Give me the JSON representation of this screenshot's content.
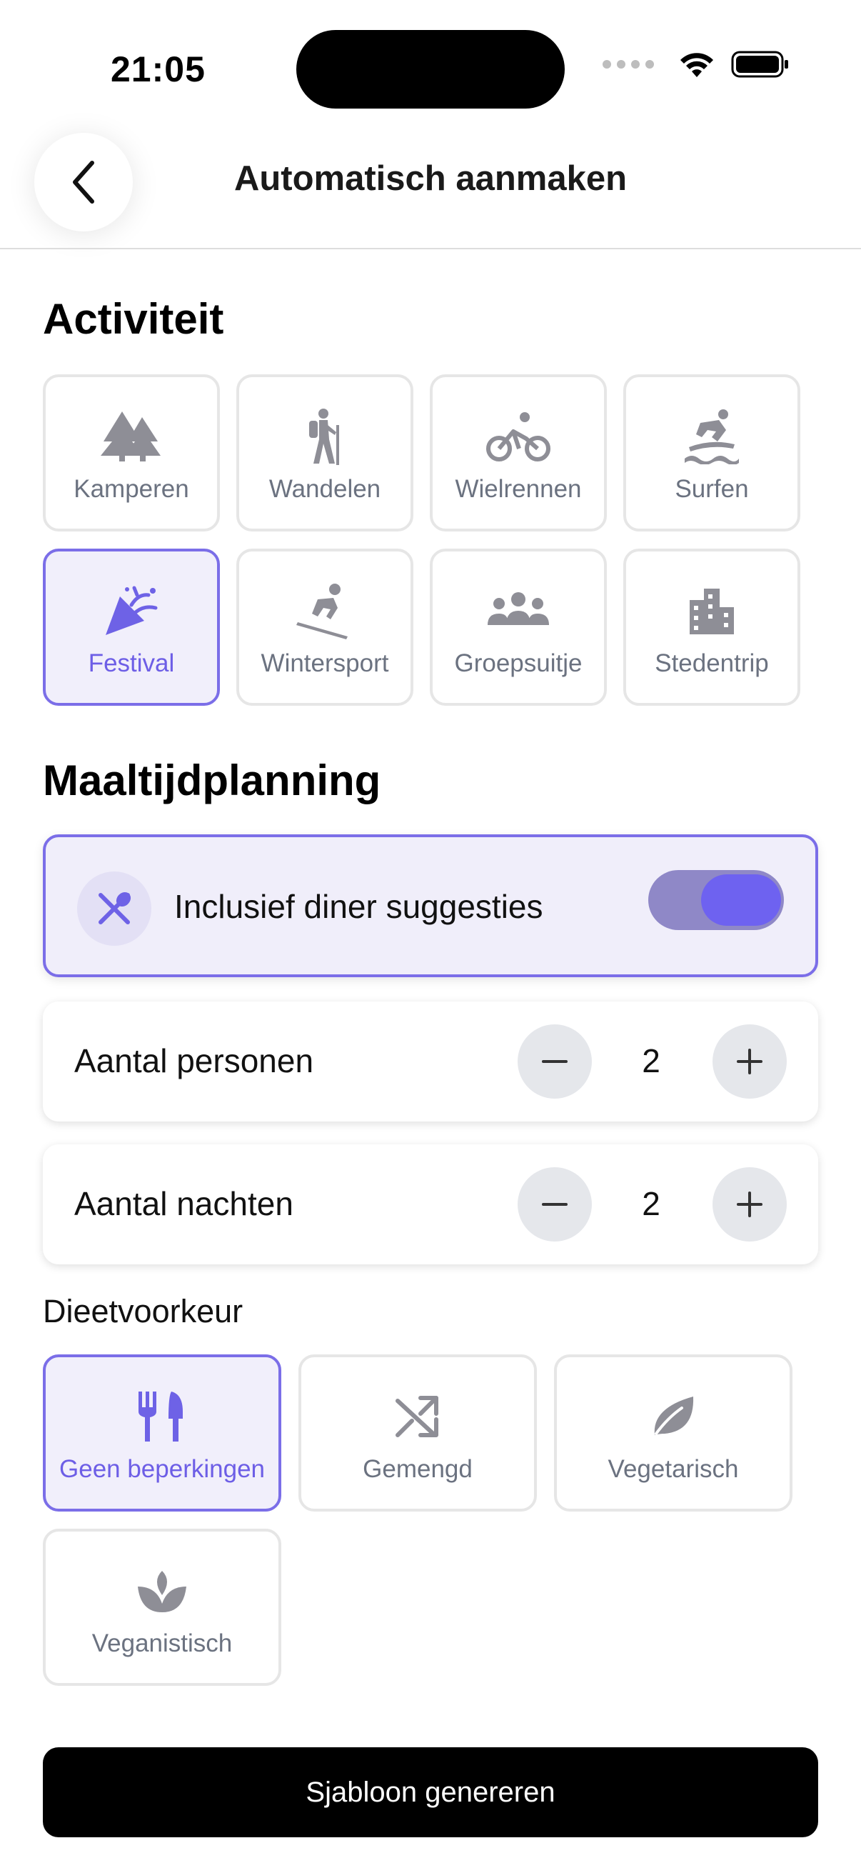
{
  "status_bar": {
    "time": "21:05"
  },
  "header": {
    "title": "Automatisch aanmaken",
    "back_icon": "chevron-left-icon"
  },
  "activity_section": {
    "title": "Activiteit",
    "options": [
      {
        "label": "Kamperen",
        "icon": "trees-icon",
        "selected": false
      },
      {
        "label": "Wandelen",
        "icon": "hiker-icon",
        "selected": false
      },
      {
        "label": "Wielrennen",
        "icon": "bicycle-icon",
        "selected": false
      },
      {
        "label": "Surfen",
        "icon": "surfer-icon",
        "selected": false
      },
      {
        "label": "Festival",
        "icon": "party-popper-icon",
        "selected": true
      },
      {
        "label": "Wintersport",
        "icon": "skier-icon",
        "selected": false
      },
      {
        "label": "Groepsuitje",
        "icon": "group-icon",
        "selected": false
      },
      {
        "label": "Stedentrip",
        "icon": "city-icon",
        "selected": false
      }
    ]
  },
  "meal_section": {
    "title": "Maaltijdplanning",
    "dinner_toggle": {
      "label": "Inclusief diner suggesties",
      "icon": "utensils-crossed-icon",
      "enabled": true
    },
    "persons": {
      "label": "Aantal personen",
      "value": "2"
    },
    "nights": {
      "label": "Aantal nachten",
      "value": "2"
    },
    "diet": {
      "title": "Dieetvoorkeur",
      "options": [
        {
          "label": "Geen beperkingen",
          "icon": "utensils-icon",
          "selected": true
        },
        {
          "label": "Gemengd",
          "icon": "shuffle-icon",
          "selected": false
        },
        {
          "label": "Vegetarisch",
          "icon": "leaf-icon",
          "selected": false
        },
        {
          "label": "Veganistisch",
          "icon": "sprout-icon",
          "selected": false
        }
      ]
    }
  },
  "generate_button": {
    "label": "Sjabloon genereren"
  },
  "colors": {
    "accent": "#7B6EE8",
    "accent_text": "#6D5EE6",
    "muted_icon": "#8E8E96",
    "button_bg": "#000000"
  }
}
